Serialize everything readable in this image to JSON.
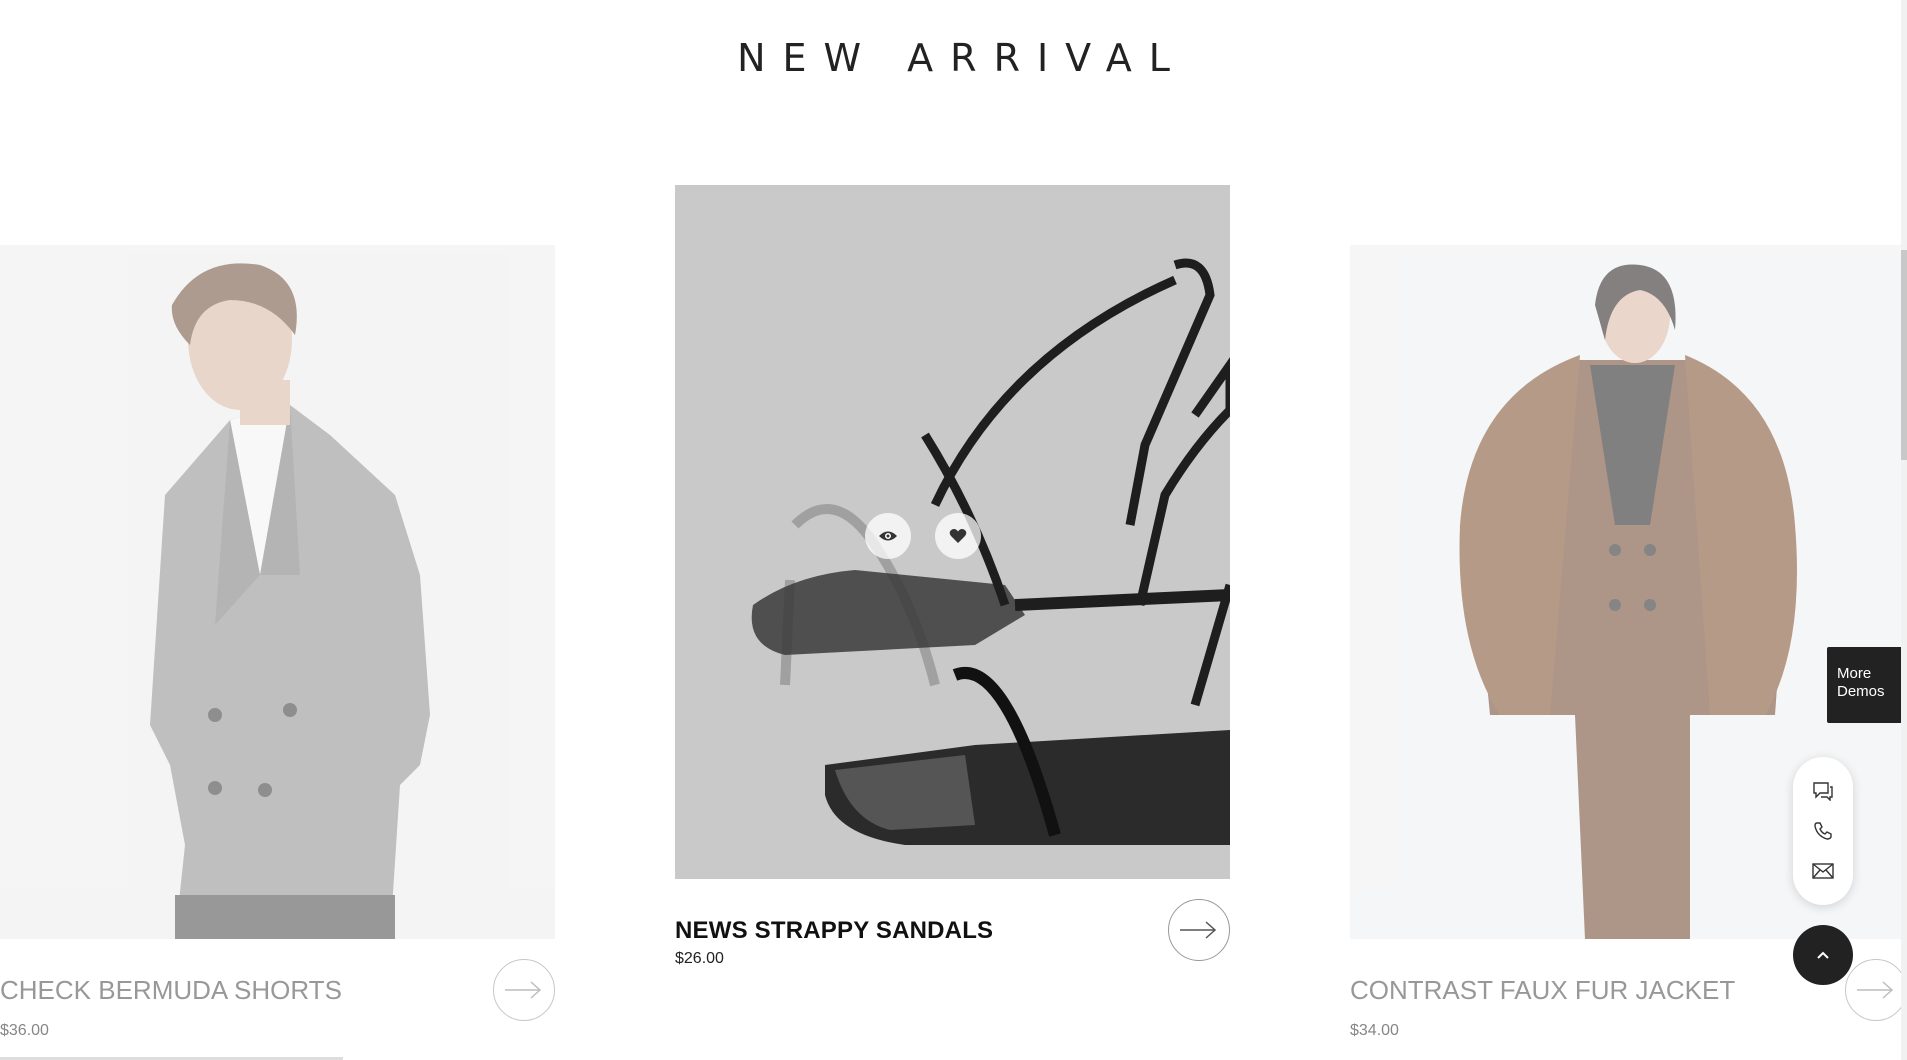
{
  "section": {
    "title": "NEW ARRIVAL"
  },
  "products": [
    {
      "title": "CHECK BERMUDA SHORTS",
      "price": "$36.00",
      "state": "faded"
    },
    {
      "title": "NEWS STRAPPY SANDALS",
      "price": "$26.00",
      "state": "active"
    },
    {
      "title": "CONTRAST FAUX FUR JACKET",
      "price": "$34.00",
      "state": "faded"
    }
  ],
  "hover_icons": [
    "eye-icon",
    "heart-icon"
  ],
  "more_demos": {
    "line1": "More",
    "line2": "Demos"
  },
  "contact_icons": [
    "chat-icon",
    "phone-icon",
    "mail-icon"
  ],
  "scroll_top_icon": "chevron-up-icon",
  "colors": {
    "dark": "#222222",
    "card_bg_active": "#c9c9c9"
  }
}
